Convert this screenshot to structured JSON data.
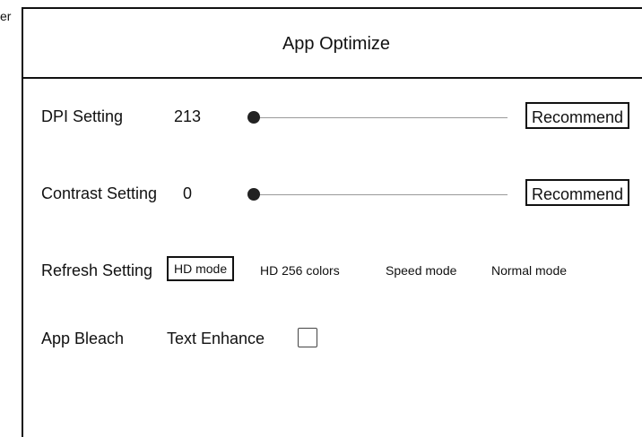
{
  "background_clip_text": "er",
  "dialog": {
    "title": "App Optimize"
  },
  "dpi": {
    "label": "DPI Setting",
    "value": "213",
    "level": 0.0,
    "recommend_label": "Recommend"
  },
  "contrast": {
    "label": "Contrast Setting",
    "value": "0",
    "level": 0.0,
    "recommend_label": "Recommend"
  },
  "refresh": {
    "label": "Refresh Setting",
    "options": [
      "HD mode",
      "HD 256 colors",
      "Speed mode",
      "Normal mode"
    ],
    "selected": "HD mode"
  },
  "bleach": {
    "label": "App Bleach",
    "text_enhance_label": "Text Enhance",
    "text_enhance_checked": false
  }
}
